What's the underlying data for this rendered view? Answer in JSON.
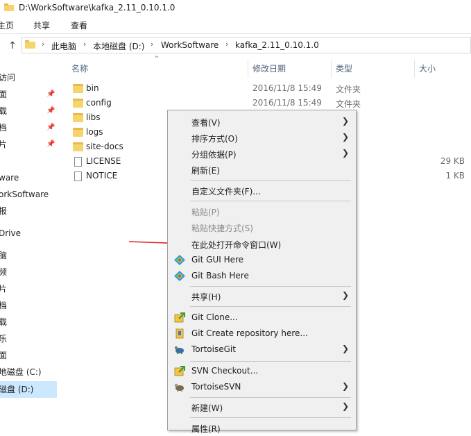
{
  "window": {
    "title": "D:\\WorkSoftware\\kafka_2.11_0.10.1.0"
  },
  "ribbon": {
    "tabs": [
      "主页",
      "共享",
      "查看"
    ]
  },
  "address": {
    "crumbs": [
      "此电脑",
      "本地磁盘 (D:)",
      "WorkSoftware",
      "kafka_2.11_0.10.1.0"
    ]
  },
  "nav": {
    "items": [
      "访问",
      "面",
      "载",
      "档",
      "片",
      "ware",
      "orkSoftware",
      "报",
      "Drive",
      "脑",
      "频",
      "片",
      "档",
      "载",
      "乐",
      "面",
      "地磁盘 (C:)",
      "磁盘 (D:)"
    ]
  },
  "columns": {
    "name": "名称",
    "date": "修改日期",
    "type": "类型",
    "size": "大小"
  },
  "files": [
    {
      "name": "bin",
      "date": "2016/11/8 15:49",
      "type": "文件夹",
      "size": "",
      "kind": "folder"
    },
    {
      "name": "config",
      "date": "2016/11/8 15:49",
      "type": "文件夹",
      "size": "",
      "kind": "folder"
    },
    {
      "name": "libs",
      "date": "",
      "type": "",
      "size": "",
      "kind": "folder"
    },
    {
      "name": "logs",
      "date": "",
      "type": "",
      "size": "",
      "kind": "folder"
    },
    {
      "name": "site-docs",
      "date": "",
      "type": "",
      "size": "",
      "kind": "folder"
    },
    {
      "name": "LICENSE",
      "date": "",
      "type": "",
      "size": "29 KB",
      "kind": "file"
    },
    {
      "name": "NOTICE",
      "date": "",
      "type": "",
      "size": "1 KB",
      "kind": "file"
    }
  ],
  "context_menu": {
    "view": "查看(V)",
    "sort": "排序方式(O)",
    "group": "分组依据(P)",
    "refresh": "刷新(E)",
    "customize": "自定义文件夹(F)...",
    "paste": "粘贴(P)",
    "paste_shortcut": "粘贴快捷方式(S)",
    "open_cmd": "在此处打开命令窗口(W)",
    "git_gui": "Git GUI Here",
    "git_bash": "Git Bash Here",
    "share": "共享(H)",
    "git_clone": "Git Clone...",
    "git_create": "Git Create repository here...",
    "tortoisegit": "TortoiseGit",
    "svn_checkout": "SVN Checkout...",
    "tortoisesvn": "TortoiseSVN",
    "new": "新建(W)",
    "properties": "属性(R)"
  },
  "colors": {
    "selection": "#cce8ff",
    "menu_bg": "#f0f0f0",
    "arrow": "#e02020",
    "folder": "#f7d46a"
  }
}
